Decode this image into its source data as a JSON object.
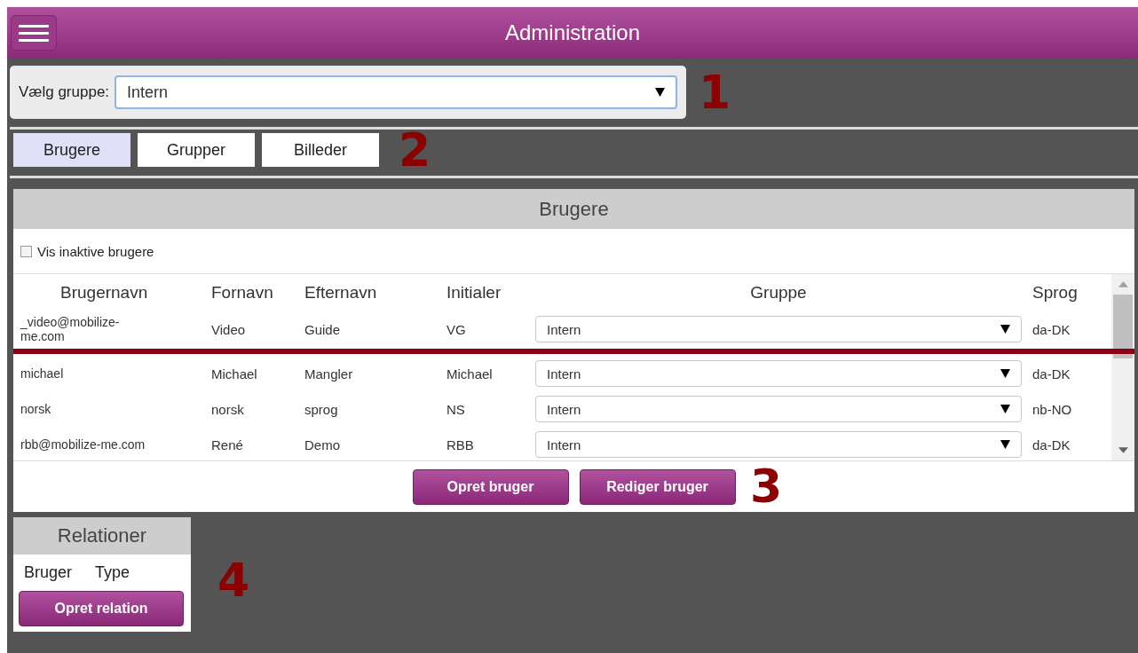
{
  "header": {
    "title": "Administration"
  },
  "group_select": {
    "label": "Vælg gruppe:",
    "value": "Intern"
  },
  "tabs": [
    {
      "label": "Brugere",
      "selected": true
    },
    {
      "label": "Grupper",
      "selected": false
    },
    {
      "label": "Billeder",
      "selected": false
    }
  ],
  "users_panel": {
    "title": "Brugere",
    "show_inactive": {
      "label": "Vis inaktive brugere",
      "checked": false
    },
    "columns": [
      "Brugernavn",
      "Fornavn",
      "Efternavn",
      "Initialer",
      "Gruppe",
      "Sprog"
    ],
    "rows": [
      {
        "username": "_video@mobilize-me.com",
        "first_name": "Video",
        "last_name": "Guide",
        "initials": "VG",
        "group": "Intern",
        "language": "da-DK"
      },
      {
        "username": "michael",
        "first_name": "Michael",
        "last_name": "Mangler",
        "initials": "Michael",
        "group": "Intern",
        "language": "da-DK"
      },
      {
        "username": "norsk",
        "first_name": "norsk",
        "last_name": "sprog",
        "initials": "NS",
        "group": "Intern",
        "language": "nb-NO"
      },
      {
        "username": "rbb@mobilize-me.com",
        "first_name": "René",
        "last_name": "Demo",
        "initials": "RBB",
        "group": "Intern",
        "language": "da-DK"
      }
    ],
    "buttons": [
      "Opret bruger",
      "Rediger bruger"
    ]
  },
  "relations_panel": {
    "title": "Relationer",
    "columns": [
      "Bruger",
      "Type"
    ],
    "button": "Opret relation"
  },
  "annotations": [
    "1",
    "2",
    "3",
    "4"
  ]
}
